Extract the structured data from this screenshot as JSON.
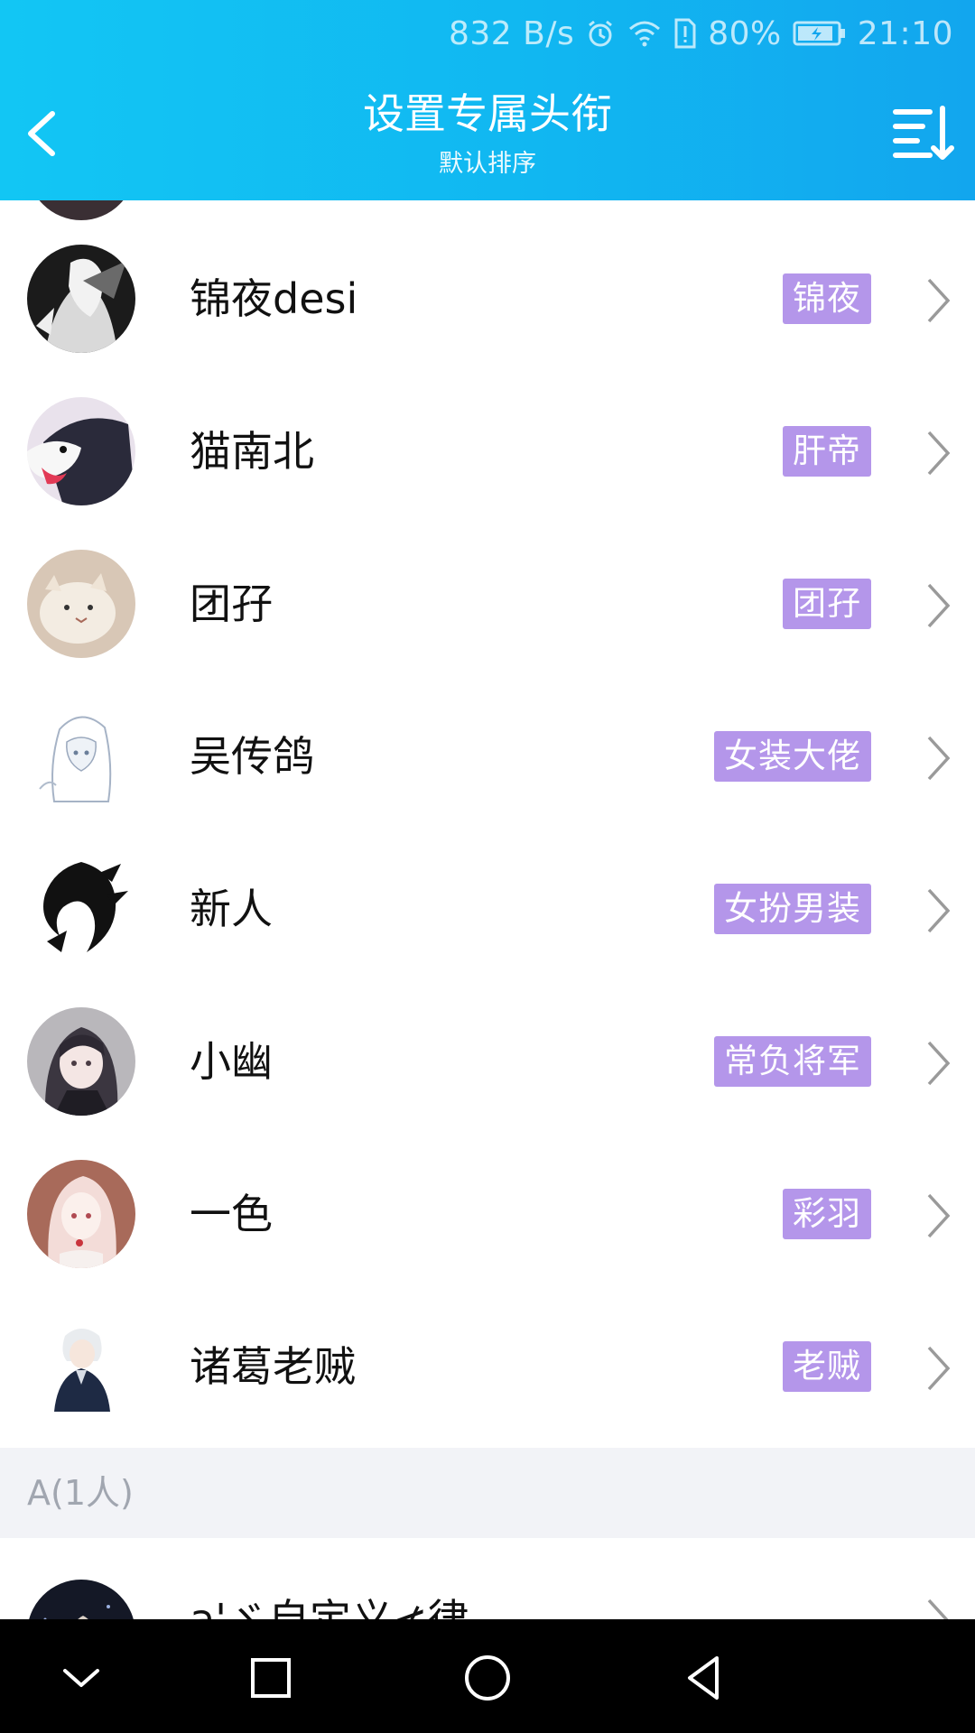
{
  "status_bar": {
    "net_speed": "832 B/s",
    "battery": "80%",
    "time": "21:10"
  },
  "header": {
    "title": "设置专属头衔",
    "subtitle": "默认排序"
  },
  "members": [
    {
      "name": "锦夜desi",
      "title": "锦夜"
    },
    {
      "name": "猫南北",
      "title": "肝帝"
    },
    {
      "name": "团孖",
      "title": "团孖"
    },
    {
      "name": "吴传鸽",
      "title": "女装大佬"
    },
    {
      "name": "新人",
      "title": "女扮男装"
    },
    {
      "name": "小幽",
      "title": "常负将军"
    },
    {
      "name": "一色",
      "title": "彩羽"
    },
    {
      "name": "诸葛老贼",
      "title": "老贼"
    }
  ],
  "section_header": "A(1人)",
  "partial_member": {
    "name": "a'ゞ自定义≮律"
  },
  "colors": {
    "header_gradient_start": "#12c6f4",
    "header_gradient_end": "#12a6ee",
    "badge": "#b496ea",
    "section_bg": "#f2f3f7",
    "nav_bar": "#000000"
  },
  "icons": {
    "back": "back-arrow-icon",
    "sort": "sort-list-icon",
    "chevron": "chevron-right-icon",
    "nav_hide": "chevron-down-icon",
    "nav_recents": "square-icon",
    "nav_home": "circle-icon",
    "nav_back": "triangle-back-icon"
  }
}
